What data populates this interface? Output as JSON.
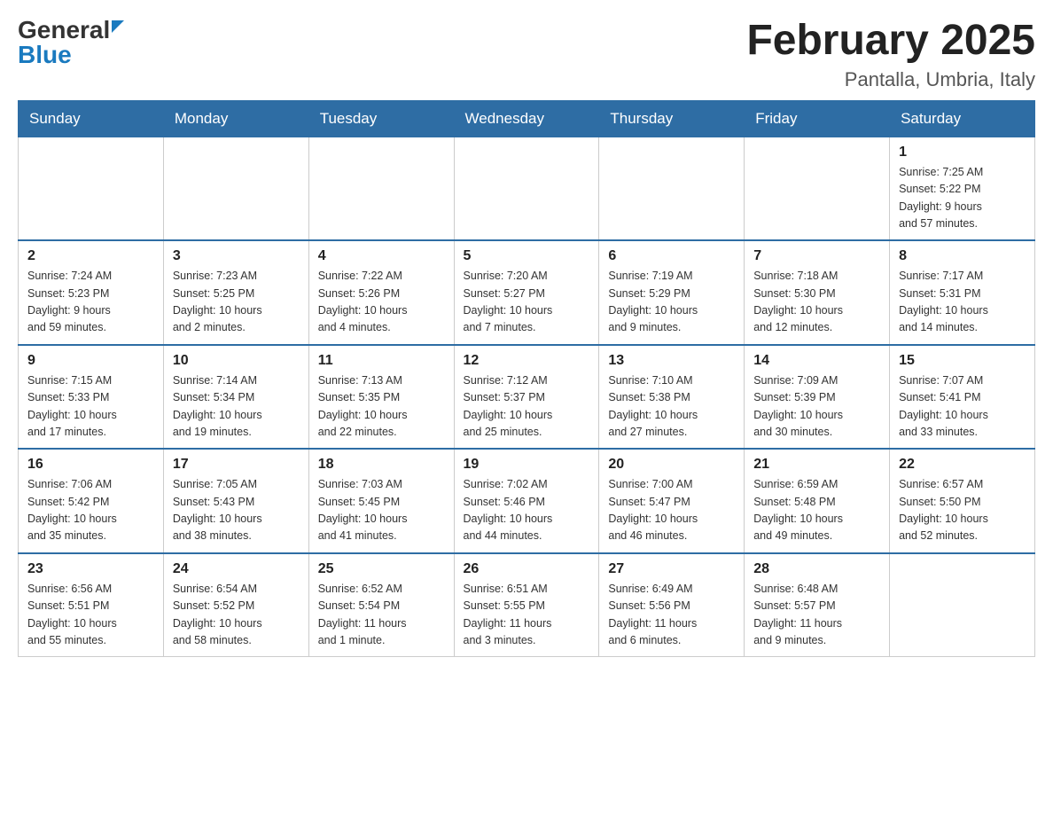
{
  "header": {
    "logo_general": "General",
    "logo_blue": "Blue",
    "month_title": "February 2025",
    "location": "Pantalla, Umbria, Italy"
  },
  "weekdays": [
    "Sunday",
    "Monday",
    "Tuesday",
    "Wednesday",
    "Thursday",
    "Friday",
    "Saturday"
  ],
  "weeks": [
    [
      {
        "day": "",
        "info": ""
      },
      {
        "day": "",
        "info": ""
      },
      {
        "day": "",
        "info": ""
      },
      {
        "day": "",
        "info": ""
      },
      {
        "day": "",
        "info": ""
      },
      {
        "day": "",
        "info": ""
      },
      {
        "day": "1",
        "info": "Sunrise: 7:25 AM\nSunset: 5:22 PM\nDaylight: 9 hours\nand 57 minutes."
      }
    ],
    [
      {
        "day": "2",
        "info": "Sunrise: 7:24 AM\nSunset: 5:23 PM\nDaylight: 9 hours\nand 59 minutes."
      },
      {
        "day": "3",
        "info": "Sunrise: 7:23 AM\nSunset: 5:25 PM\nDaylight: 10 hours\nand 2 minutes."
      },
      {
        "day": "4",
        "info": "Sunrise: 7:22 AM\nSunset: 5:26 PM\nDaylight: 10 hours\nand 4 minutes."
      },
      {
        "day": "5",
        "info": "Sunrise: 7:20 AM\nSunset: 5:27 PM\nDaylight: 10 hours\nand 7 minutes."
      },
      {
        "day": "6",
        "info": "Sunrise: 7:19 AM\nSunset: 5:29 PM\nDaylight: 10 hours\nand 9 minutes."
      },
      {
        "day": "7",
        "info": "Sunrise: 7:18 AM\nSunset: 5:30 PM\nDaylight: 10 hours\nand 12 minutes."
      },
      {
        "day": "8",
        "info": "Sunrise: 7:17 AM\nSunset: 5:31 PM\nDaylight: 10 hours\nand 14 minutes."
      }
    ],
    [
      {
        "day": "9",
        "info": "Sunrise: 7:15 AM\nSunset: 5:33 PM\nDaylight: 10 hours\nand 17 minutes."
      },
      {
        "day": "10",
        "info": "Sunrise: 7:14 AM\nSunset: 5:34 PM\nDaylight: 10 hours\nand 19 minutes."
      },
      {
        "day": "11",
        "info": "Sunrise: 7:13 AM\nSunset: 5:35 PM\nDaylight: 10 hours\nand 22 minutes."
      },
      {
        "day": "12",
        "info": "Sunrise: 7:12 AM\nSunset: 5:37 PM\nDaylight: 10 hours\nand 25 minutes."
      },
      {
        "day": "13",
        "info": "Sunrise: 7:10 AM\nSunset: 5:38 PM\nDaylight: 10 hours\nand 27 minutes."
      },
      {
        "day": "14",
        "info": "Sunrise: 7:09 AM\nSunset: 5:39 PM\nDaylight: 10 hours\nand 30 minutes."
      },
      {
        "day": "15",
        "info": "Sunrise: 7:07 AM\nSunset: 5:41 PM\nDaylight: 10 hours\nand 33 minutes."
      }
    ],
    [
      {
        "day": "16",
        "info": "Sunrise: 7:06 AM\nSunset: 5:42 PM\nDaylight: 10 hours\nand 35 minutes."
      },
      {
        "day": "17",
        "info": "Sunrise: 7:05 AM\nSunset: 5:43 PM\nDaylight: 10 hours\nand 38 minutes."
      },
      {
        "day": "18",
        "info": "Sunrise: 7:03 AM\nSunset: 5:45 PM\nDaylight: 10 hours\nand 41 minutes."
      },
      {
        "day": "19",
        "info": "Sunrise: 7:02 AM\nSunset: 5:46 PM\nDaylight: 10 hours\nand 44 minutes."
      },
      {
        "day": "20",
        "info": "Sunrise: 7:00 AM\nSunset: 5:47 PM\nDaylight: 10 hours\nand 46 minutes."
      },
      {
        "day": "21",
        "info": "Sunrise: 6:59 AM\nSunset: 5:48 PM\nDaylight: 10 hours\nand 49 minutes."
      },
      {
        "day": "22",
        "info": "Sunrise: 6:57 AM\nSunset: 5:50 PM\nDaylight: 10 hours\nand 52 minutes."
      }
    ],
    [
      {
        "day": "23",
        "info": "Sunrise: 6:56 AM\nSunset: 5:51 PM\nDaylight: 10 hours\nand 55 minutes."
      },
      {
        "day": "24",
        "info": "Sunrise: 6:54 AM\nSunset: 5:52 PM\nDaylight: 10 hours\nand 58 minutes."
      },
      {
        "day": "25",
        "info": "Sunrise: 6:52 AM\nSunset: 5:54 PM\nDaylight: 11 hours\nand 1 minute."
      },
      {
        "day": "26",
        "info": "Sunrise: 6:51 AM\nSunset: 5:55 PM\nDaylight: 11 hours\nand 3 minutes."
      },
      {
        "day": "27",
        "info": "Sunrise: 6:49 AM\nSunset: 5:56 PM\nDaylight: 11 hours\nand 6 minutes."
      },
      {
        "day": "28",
        "info": "Sunrise: 6:48 AM\nSunset: 5:57 PM\nDaylight: 11 hours\nand 9 minutes."
      },
      {
        "day": "",
        "info": ""
      }
    ]
  ]
}
